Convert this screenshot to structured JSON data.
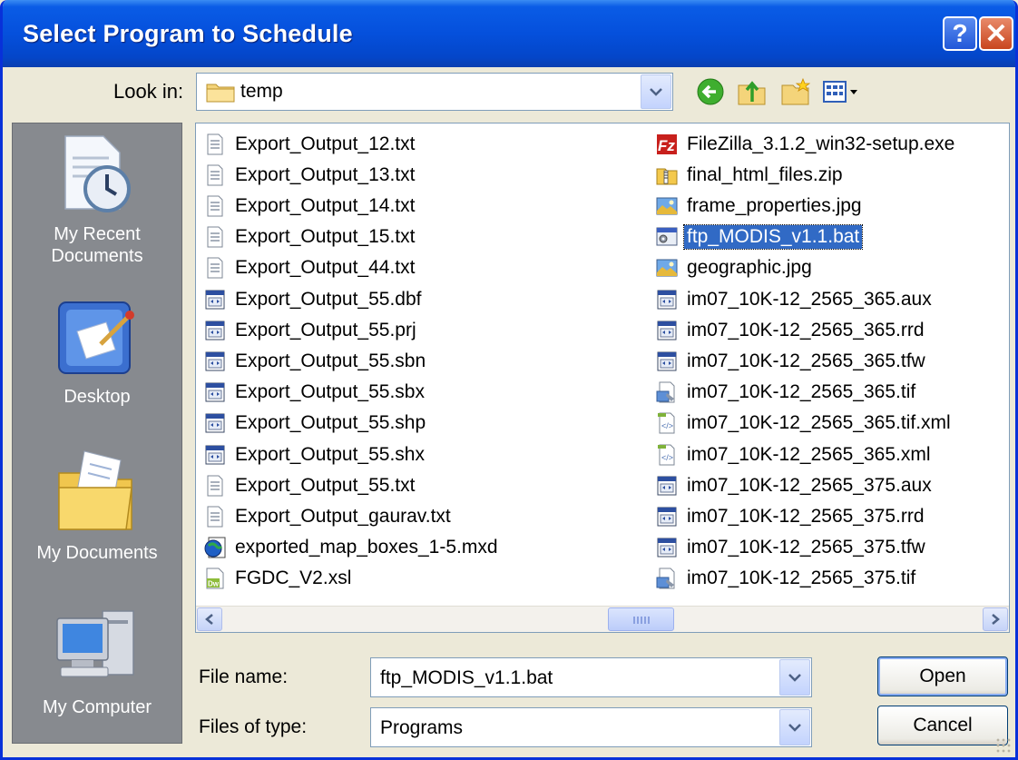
{
  "window": {
    "title": "Select Program to Schedule",
    "help_glyph": "?",
    "close_glyph": "✕"
  },
  "lookin": {
    "label": "Look in:",
    "value": "temp"
  },
  "places": [
    {
      "label": "My Recent Documents",
      "icon": "recent-documents-icon"
    },
    {
      "label": "Desktop",
      "icon": "desktop-icon"
    },
    {
      "label": "My Documents",
      "icon": "my-documents-icon"
    },
    {
      "label": "My Computer",
      "icon": "my-computer-icon"
    }
  ],
  "files": {
    "col1": [
      {
        "name": "Export_Output_12.txt",
        "icon": "text-file-icon"
      },
      {
        "name": "Export_Output_13.txt",
        "icon": "text-file-icon"
      },
      {
        "name": "Export_Output_14.txt",
        "icon": "text-file-icon"
      },
      {
        "name": "Export_Output_15.txt",
        "icon": "text-file-icon"
      },
      {
        "name": "Export_Output_44.txt",
        "icon": "text-file-icon"
      },
      {
        "name": "Export_Output_55.dbf",
        "icon": "generic-file-icon"
      },
      {
        "name": "Export_Output_55.prj",
        "icon": "generic-file-icon"
      },
      {
        "name": "Export_Output_55.sbn",
        "icon": "generic-file-icon"
      },
      {
        "name": "Export_Output_55.sbx",
        "icon": "generic-file-icon"
      },
      {
        "name": "Export_Output_55.shp",
        "icon": "generic-file-icon"
      },
      {
        "name": "Export_Output_55.shx",
        "icon": "generic-file-icon"
      },
      {
        "name": "Export_Output_55.txt",
        "icon": "text-file-icon"
      },
      {
        "name": "Export_Output_gaurav.txt",
        "icon": "text-file-icon"
      },
      {
        "name": "exported_map_boxes_1-5.mxd",
        "icon": "map-document-icon"
      },
      {
        "name": "FGDC_V2.xsl",
        "icon": "dreamweaver-file-icon"
      }
    ],
    "col2": [
      {
        "name": "FileZilla_3.1.2_win32-setup.exe",
        "icon": "filezilla-icon"
      },
      {
        "name": "final_html_files.zip",
        "icon": "zip-folder-icon"
      },
      {
        "name": "frame_properties.jpg",
        "icon": "image-file-icon"
      },
      {
        "name": "ftp_MODIS_v1.1.bat",
        "icon": "batch-file-icon",
        "selected": true
      },
      {
        "name": "geographic.jpg",
        "icon": "image-file-icon"
      },
      {
        "name": "im07_10K-12_2565_365.aux",
        "icon": "generic-file-icon"
      },
      {
        "name": "im07_10K-12_2565_365.rrd",
        "icon": "generic-file-icon"
      },
      {
        "name": "im07_10K-12_2565_365.tfw",
        "icon": "generic-file-icon"
      },
      {
        "name": "im07_10K-12_2565_365.tif",
        "icon": "tif-file-icon"
      },
      {
        "name": "im07_10K-12_2565_365.tif.xml",
        "icon": "xml-file-icon"
      },
      {
        "name": "im07_10K-12_2565_365.xml",
        "icon": "xml-file-icon"
      },
      {
        "name": "im07_10K-12_2565_375.aux",
        "icon": "generic-file-icon"
      },
      {
        "name": "im07_10K-12_2565_375.rrd",
        "icon": "generic-file-icon"
      },
      {
        "name": "im07_10K-12_2565_375.tfw",
        "icon": "generic-file-icon"
      },
      {
        "name": "im07_10K-12_2565_375.tif",
        "icon": "tif-file-icon"
      }
    ]
  },
  "filename": {
    "label": "File name:",
    "value": "ftp_MODIS_v1.1.bat"
  },
  "filetype": {
    "label": "Files of type:",
    "value": "Programs"
  },
  "buttons": {
    "open": "Open",
    "cancel": "Cancel"
  },
  "colors": {
    "title_blue": "#0550dc",
    "selection": "#316ac5",
    "places_bg": "#878a8f",
    "dialog_bg": "#ece9d8"
  }
}
